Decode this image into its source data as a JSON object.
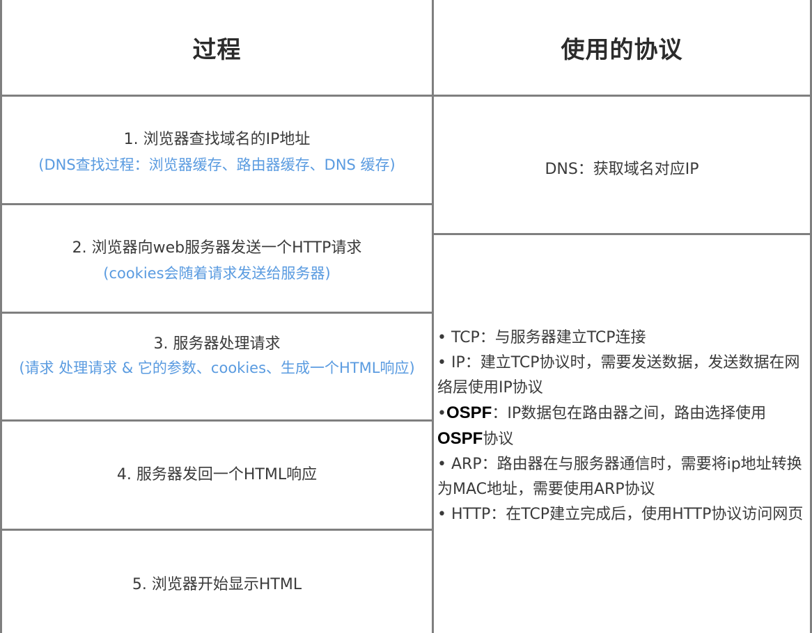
{
  "header": {
    "process": "过程",
    "protocol": "使用的协议"
  },
  "steps": [
    {
      "label": "1. 浏览器查找域名的IP地址",
      "note": "(DNS查找过程：浏览器缓存、路由器缓存、DNS 缓存)"
    },
    {
      "label": "2. 浏览器向web服务器发送一个HTTP请求",
      "note": "(cookies会随着请求发送给服务器)"
    },
    {
      "label": "3. 服务器处理请求",
      "note": "(请求 处理请求 & 它的参数、cookies、生成一个HTML响应)"
    },
    {
      "label": "4. 服务器发回一个HTML响应",
      "note": ""
    },
    {
      "label": "5. 浏览器开始显示HTML",
      "note": ""
    }
  ],
  "protocols": {
    "dns": "DNS：获取域名对应IP",
    "items": [
      {
        "bullet": "• ",
        "name": "TCP",
        "text": "：与服务器建立TCP连接"
      },
      {
        "bullet": "• ",
        "name": "IP",
        "text": "：建立TCP协议时，需要发送数据，发送数据在网络层使用IP协议"
      },
      {
        "bullet": "•",
        "name": "OSPF",
        "text": "：IP数据包在路由器之间，路由选择使用 ",
        "name2": "OSPF",
        "text2": "协议"
      },
      {
        "bullet": "• ",
        "name": "ARP",
        "text": "：路由器在与服务器通信时，需要将ip地址转换为MAC地址，需要使用ARP协议"
      },
      {
        "bullet": "• ",
        "name": "HTTP",
        "text": "：在TCP建立完成后，使用HTTP协议访问网页"
      }
    ]
  }
}
